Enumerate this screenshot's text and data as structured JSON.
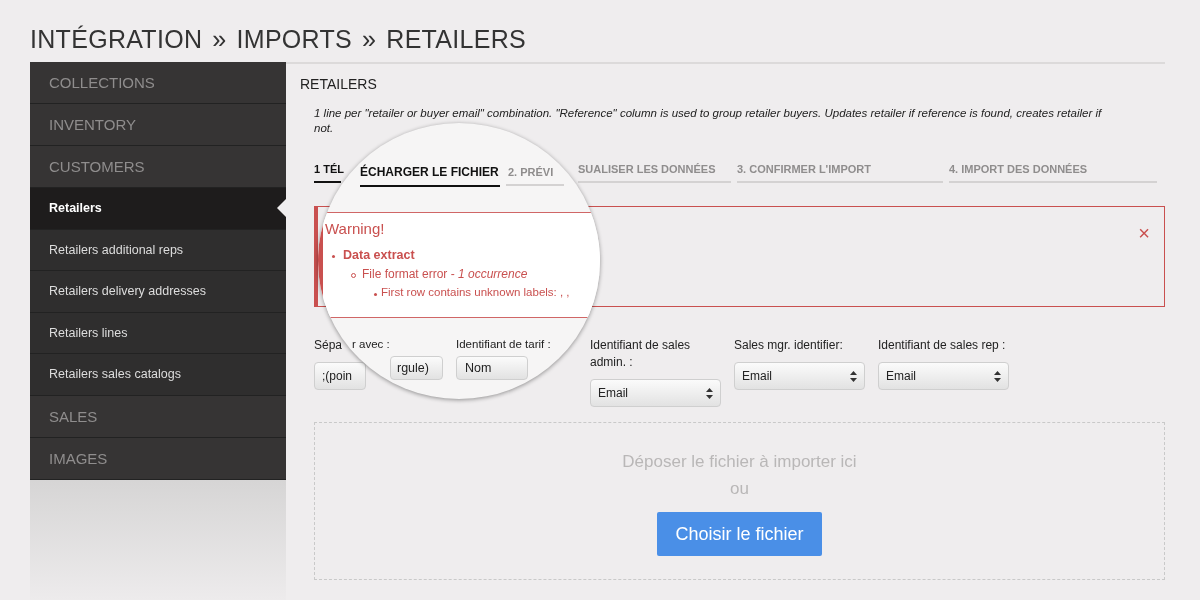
{
  "breadcrumb": {
    "items": [
      "INTÉGRATION",
      "IMPORTS",
      "RETAILERS"
    ],
    "separator": "»"
  },
  "sidebar": {
    "items": [
      {
        "label": "COLLECTIONS",
        "kind": "section",
        "selected": false
      },
      {
        "label": "INVENTORY",
        "kind": "section",
        "selected": false
      },
      {
        "label": "CUSTOMERS",
        "kind": "section",
        "selected": false
      },
      {
        "label": "Retailers",
        "kind": "sub",
        "selected": true
      },
      {
        "label": "Retailers additional reps",
        "kind": "sub",
        "selected": false
      },
      {
        "label": "Retailers delivery addresses",
        "kind": "sub",
        "selected": false
      },
      {
        "label": "Retailers lines",
        "kind": "sub",
        "selected": false
      },
      {
        "label": "Retailers sales catalogs",
        "kind": "sub",
        "selected": false
      },
      {
        "label": "SALES",
        "kind": "section",
        "selected": false
      },
      {
        "label": "IMAGES",
        "kind": "section",
        "selected": false
      }
    ]
  },
  "panel": {
    "title": "RETAILERS",
    "description": "1 line per \"retailer or buyer email\" combination. \"Reference\" column is used to group retailer buyers. Updates retailer if reference is found, creates retailer if not.",
    "steps": [
      {
        "label": "1 TÉL",
        "selected": true
      },
      {
        "label": "SUALISER LES DONNÉES",
        "selected": false
      },
      {
        "label": "3. CONFIRMER L'IMPORT",
        "selected": false
      },
      {
        "label": "4. IMPORT DES DONNÉES",
        "selected": false
      }
    ],
    "warning": {
      "close": "×"
    },
    "fields": [
      {
        "label": "Sépa",
        "value": ";(poin"
      },
      {
        "label": "Identifiant de sales admin. :",
        "value": "Email"
      },
      {
        "label": "Sales mgr. identifier:",
        "value": "Email"
      },
      {
        "label": "Identifiant de sales rep :",
        "value": "Email"
      }
    ],
    "dropzone": {
      "text": "Déposer le fichier à importer ici",
      "or": "ou",
      "button": "Choisir le fichier"
    }
  },
  "magnifier": {
    "steps": [
      {
        "label": "ÉCHARGER LE FICHIER",
        "selected": true
      },
      {
        "label": "2. PRÉVI",
        "selected": false
      }
    ],
    "warning": {
      "title": "Warning!",
      "section": "Data extract",
      "error": "File format error - *1 occurrence*",
      "detail": "First row contains unknown labels: , ,"
    },
    "fields": [
      {
        "label": "r avec :",
        "value": "rgule)"
      },
      {
        "label": "Identifiant de tarif :",
        "value": "Nom"
      }
    ]
  }
}
